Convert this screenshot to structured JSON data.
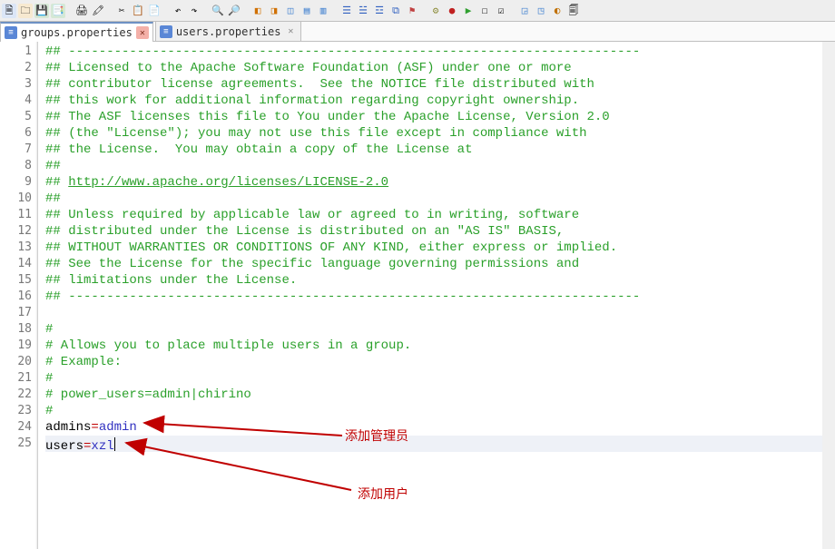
{
  "tabs": [
    {
      "label": "groups.properties",
      "active": true,
      "dirty": true
    },
    {
      "label": "users.properties",
      "active": false,
      "dirty": true
    }
  ],
  "gutter": [
    "1",
    "2",
    "3",
    "4",
    "5",
    "6",
    "7",
    "8",
    "9",
    "10",
    "11",
    "12",
    "13",
    "14",
    "15",
    "16",
    "17",
    "18",
    "19",
    "20",
    "21",
    "22",
    "23",
    "24",
    "25"
  ],
  "lines": [
    {
      "type": "cmt",
      "text": "## ---------------------------------------------------------------------------"
    },
    {
      "type": "cmt",
      "text": "## Licensed to the Apache Software Foundation (ASF) under one or more"
    },
    {
      "type": "cmt",
      "text": "## contributor license agreements.  See the NOTICE file distributed with"
    },
    {
      "type": "cmt",
      "text": "## this work for additional information regarding copyright ownership."
    },
    {
      "type": "cmt",
      "text": "## The ASF licenses this file to You under the Apache License, Version 2.0"
    },
    {
      "type": "cmt",
      "text": "## (the \"License\"); you may not use this file except in compliance with"
    },
    {
      "type": "cmt",
      "text": "## the License.  You may obtain a copy of the License at"
    },
    {
      "type": "cmt",
      "text": "##"
    },
    {
      "type": "lnk",
      "prefix": "## ",
      "text": "http://www.apache.org/licenses/LICENSE-2.0"
    },
    {
      "type": "cmt",
      "text": "##"
    },
    {
      "type": "cmt",
      "text": "## Unless required by applicable law or agreed to in writing, software"
    },
    {
      "type": "cmt",
      "text": "## distributed under the License is distributed on an \"AS IS\" BASIS,"
    },
    {
      "type": "cmt",
      "text": "## WITHOUT WARRANTIES OR CONDITIONS OF ANY KIND, either express or implied."
    },
    {
      "type": "cmt",
      "text": "## See the License for the specific language governing permissions and"
    },
    {
      "type": "cmt",
      "text": "## limitations under the License."
    },
    {
      "type": "cmt",
      "text": "## ---------------------------------------------------------------------------"
    },
    {
      "type": "blank",
      "text": ""
    },
    {
      "type": "cmt",
      "text": "#"
    },
    {
      "type": "cmt",
      "text": "# Allows you to place multiple users in a group."
    },
    {
      "type": "cmt",
      "text": "# Example:"
    },
    {
      "type": "cmt",
      "text": "#"
    },
    {
      "type": "cmt",
      "text": "# power_users=admin|chirino"
    },
    {
      "type": "cmt",
      "text": "#"
    },
    {
      "type": "prop",
      "key": "admins",
      "val": "admin"
    },
    {
      "type": "prop",
      "key": "users",
      "val": "xzl",
      "current": true
    }
  ],
  "annotations": {
    "admin_label": "添加管理员",
    "user_label": "添加用户"
  },
  "colors": {
    "comment": "#2aa02a",
    "annotation": "#c00000"
  }
}
